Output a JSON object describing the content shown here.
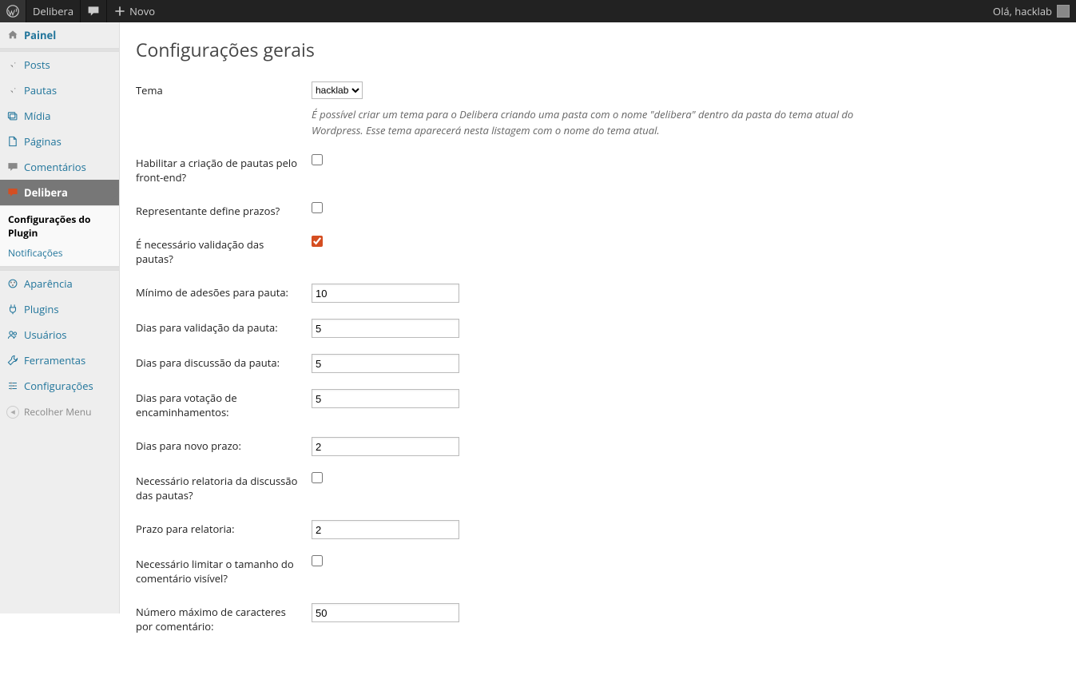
{
  "adminbar": {
    "site_name": "Delibera",
    "new_label": "Novo",
    "greeting": "Olá, hacklab"
  },
  "sidebar": {
    "items": [
      {
        "id": "painel",
        "label": "Painel",
        "icon": "home"
      },
      {
        "id": "posts",
        "label": "Posts",
        "icon": "pin"
      },
      {
        "id": "pautas",
        "label": "Pautas",
        "icon": "pin"
      },
      {
        "id": "midia",
        "label": "Mídia",
        "icon": "media"
      },
      {
        "id": "paginas",
        "label": "Páginas",
        "icon": "page"
      },
      {
        "id": "comentarios",
        "label": "Comentários",
        "icon": "comment"
      },
      {
        "id": "delibera",
        "label": "Delibera",
        "icon": "chat",
        "current": true
      },
      {
        "id": "aparencia",
        "label": "Aparência",
        "icon": "appearance"
      },
      {
        "id": "plugins",
        "label": "Plugins",
        "icon": "plug"
      },
      {
        "id": "usuarios",
        "label": "Usuários",
        "icon": "users"
      },
      {
        "id": "ferramentas",
        "label": "Ferramentas",
        "icon": "tools"
      },
      {
        "id": "configuracoes",
        "label": "Configurações",
        "icon": "settings"
      }
    ],
    "submenu": {
      "config_plugin": "Configurações do Plugin",
      "notificacoes": "Notificações"
    },
    "collapse": "Recolher Menu"
  },
  "page": {
    "title": "Configurações gerais",
    "rows": [
      {
        "type": "select",
        "label": "Tema",
        "value": "hacklab",
        "desc": "É possível criar um tema para o Delibera criando uma pasta com o nome \"delibera\" dentro da pasta do tema atual do Wordpress. Esse tema aparecerá nesta listagem com o nome do tema atual."
      },
      {
        "type": "checkbox",
        "label": "Habilitar a criação de pautas pelo front-end?",
        "checked": false
      },
      {
        "type": "checkbox",
        "label": "Representante define prazos?",
        "checked": false
      },
      {
        "type": "checkbox",
        "label": "É necessário validação das pautas?",
        "checked": true
      },
      {
        "type": "text",
        "label": "Mínimo de adesões para pauta:",
        "value": "10"
      },
      {
        "type": "text",
        "label": "Dias para validação da pauta:",
        "value": "5"
      },
      {
        "type": "text",
        "label": "Dias para discussão da pauta:",
        "value": "5"
      },
      {
        "type": "text",
        "label": "Dias para votação de encaminhamentos:",
        "value": "5"
      },
      {
        "type": "text",
        "label": "Dias para novo prazo:",
        "value": "2"
      },
      {
        "type": "checkbox",
        "label": "Necessário relatoria da discussão das pautas?",
        "checked": false
      },
      {
        "type": "text",
        "label": "Prazo para relatoria:",
        "value": "2"
      },
      {
        "type": "checkbox",
        "label": "Necessário limitar o tamanho do comentário visível?",
        "checked": false
      },
      {
        "type": "text",
        "label": "Número máximo de caracteres por comentário:",
        "value": "50"
      }
    ]
  }
}
